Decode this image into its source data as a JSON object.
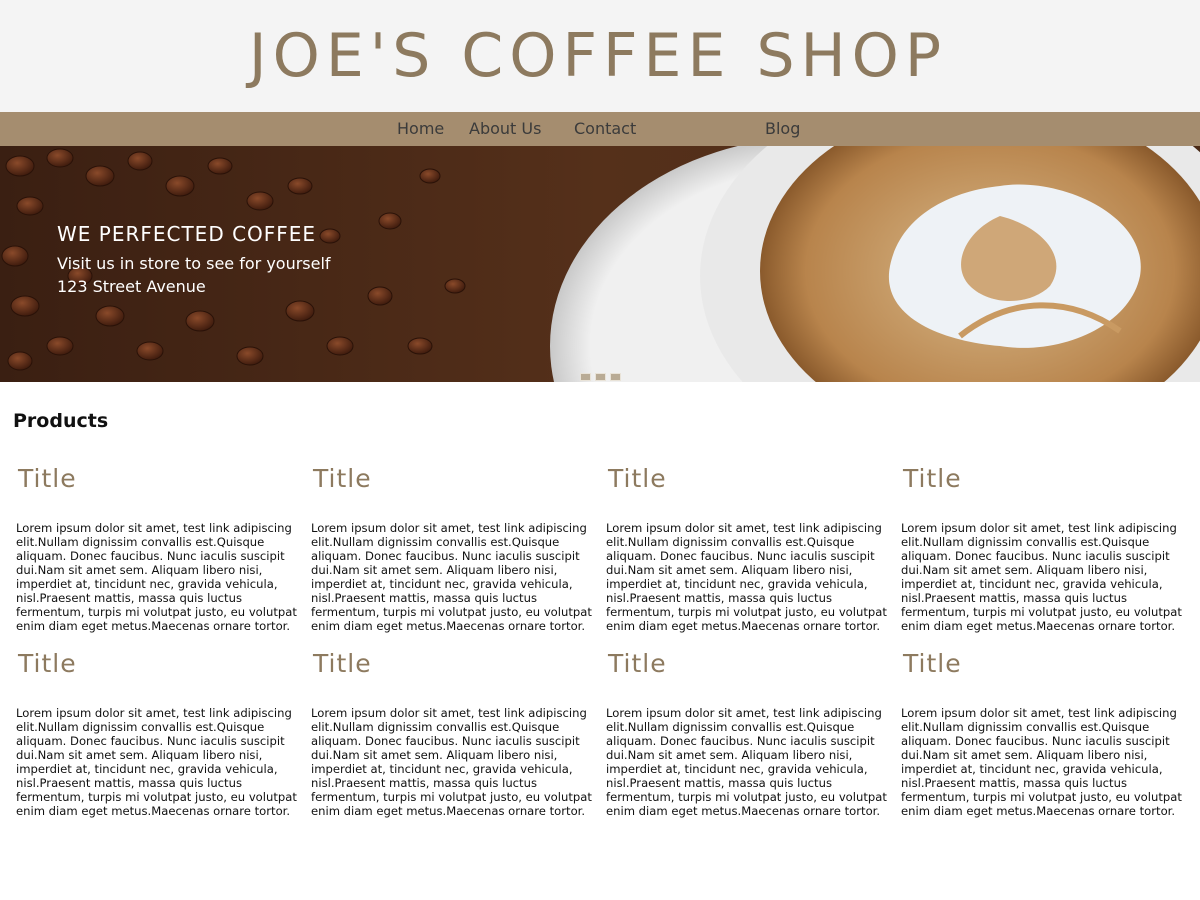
{
  "header": {
    "title": "JOE'S COFFEE SHOP"
  },
  "nav": {
    "items": [
      {
        "label": "Home"
      },
      {
        "label": "About Us"
      },
      {
        "label": "Contact"
      },
      {
        "label": "Blog"
      }
    ]
  },
  "hero": {
    "headline": "WE PERFECTED COFFEE",
    "line1": "Visit us in store to see for yourself",
    "line2": "123 Street Avenue",
    "slide_count": 3
  },
  "products": {
    "heading": "Products",
    "cards": [
      {
        "title": "Title",
        "text": "Lorem ipsum dolor sit amet, test link adipiscing elit.Nullam dignissim convallis est.Quisque aliquam. Donec faucibus. Nunc iaculis suscipit dui.Nam sit amet sem. Aliquam libero nisi, imperdiet at, tincidunt nec, gravida vehicula, nisl.Praesent mattis, massa quis luctus fermentum, turpis mi volutpat justo, eu volutpat enim diam eget metus.Maecenas ornare tortor."
      },
      {
        "title": "Title",
        "text": "Lorem ipsum dolor sit amet, test link adipiscing elit.Nullam dignissim convallis est.Quisque aliquam. Donec faucibus. Nunc iaculis suscipit dui.Nam sit amet sem. Aliquam libero nisi, imperdiet at, tincidunt nec, gravida vehicula, nisl.Praesent mattis, massa quis luctus fermentum, turpis mi volutpat justo, eu volutpat enim diam eget metus.Maecenas ornare tortor."
      },
      {
        "title": "Title",
        "text": "Lorem ipsum dolor sit amet, test link adipiscing elit.Nullam dignissim convallis est.Quisque aliquam. Donec faucibus. Nunc iaculis suscipit dui.Nam sit amet sem. Aliquam libero nisi, imperdiet at, tincidunt nec, gravida vehicula, nisl.Praesent mattis, massa quis luctus fermentum, turpis mi volutpat justo, eu volutpat enim diam eget metus.Maecenas ornare tortor."
      },
      {
        "title": "Title",
        "text": "Lorem ipsum dolor sit amet, test link adipiscing elit.Nullam dignissim convallis est.Quisque aliquam. Donec faucibus. Nunc iaculis suscipit dui.Nam sit amet sem. Aliquam libero nisi, imperdiet at, tincidunt nec, gravida vehicula, nisl.Praesent mattis, massa quis luctus fermentum, turpis mi volutpat justo, eu volutpat enim diam eget metus.Maecenas ornare tortor."
      },
      {
        "title": "Title",
        "text": "Lorem ipsum dolor sit amet, test link adipiscing elit.Nullam dignissim convallis est.Quisque aliquam. Donec faucibus. Nunc iaculis suscipit dui.Nam sit amet sem. Aliquam libero nisi, imperdiet at, tincidunt nec, gravida vehicula, nisl.Praesent mattis, massa quis luctus fermentum, turpis mi volutpat justo, eu volutpat enim diam eget metus.Maecenas ornare tortor."
      },
      {
        "title": "Title",
        "text": "Lorem ipsum dolor sit amet, test link adipiscing elit.Nullam dignissim convallis est.Quisque aliquam. Donec faucibus. Nunc iaculis suscipit dui.Nam sit amet sem. Aliquam libero nisi, imperdiet at, tincidunt nec, gravida vehicula, nisl.Praesent mattis, massa quis luctus fermentum, turpis mi volutpat justo, eu volutpat enim diam eget metus.Maecenas ornare tortor."
      },
      {
        "title": "Title",
        "text": "Lorem ipsum dolor sit amet, test link adipiscing elit.Nullam dignissim convallis est.Quisque aliquam. Donec faucibus. Nunc iaculis suscipit dui.Nam sit amet sem. Aliquam libero nisi, imperdiet at, tincidunt nec, gravida vehicula, nisl.Praesent mattis, massa quis luctus fermentum, turpis mi volutpat justo, eu volutpat enim diam eget metus.Maecenas ornare tortor."
      },
      {
        "title": "Title",
        "text": "Lorem ipsum dolor sit amet, test link adipiscing elit.Nullam dignissim convallis est.Quisque aliquam. Donec faucibus. Nunc iaculis suscipit dui.Nam sit amet sem. Aliquam libero nisi, imperdiet at, tincidunt nec, gravida vehicula, nisl.Praesent mattis, massa quis luctus fermentum, turpis mi volutpat justo, eu volutpat enim diam eget metus.Maecenas ornare tortor."
      }
    ]
  },
  "colors": {
    "brand": "#8d7a5f",
    "nav_bar": "#a58d6f",
    "header_bg": "#f4f4f4"
  }
}
